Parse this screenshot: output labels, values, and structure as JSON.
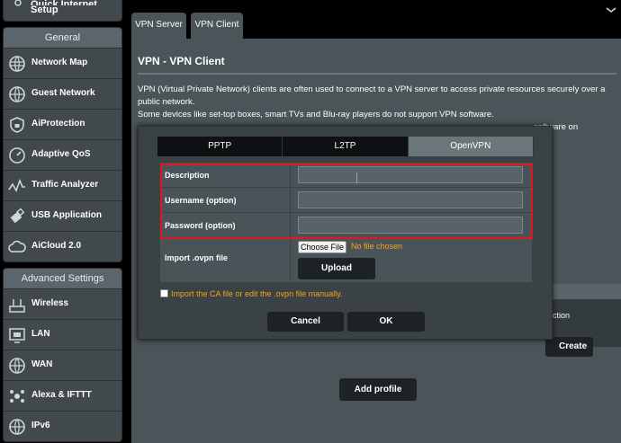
{
  "sidebar": {
    "top_item": {
      "label_top": "Quick Internet",
      "label": "Setup"
    },
    "general": {
      "header": "General",
      "items": [
        {
          "label": "Network Map",
          "icon": "network-map-icon"
        },
        {
          "label": "Guest Network",
          "icon": "globe-icon"
        },
        {
          "label": "AiProtection",
          "icon": "shield-lock-icon"
        },
        {
          "label": "Adaptive QoS",
          "icon": "qos-gauge-icon"
        },
        {
          "label": "Traffic Analyzer",
          "icon": "traffic-chart-icon"
        },
        {
          "label": "USB Application",
          "icon": "usb-icon"
        },
        {
          "label": "AiCloud 2.0",
          "icon": "cloud-icon"
        }
      ]
    },
    "advanced": {
      "header": "Advanced Settings",
      "items": [
        {
          "label": "Wireless",
          "icon": "wireless-icon"
        },
        {
          "label": "LAN",
          "icon": "lan-icon"
        },
        {
          "label": "WAN",
          "icon": "wan-globe-icon"
        },
        {
          "label": "Alexa & IFTTT",
          "icon": "alexa-ifttt-icon"
        },
        {
          "label": "IPv6",
          "icon": "ipv6-globe-icon"
        }
      ]
    }
  },
  "tabs": {
    "server": "VPN Server",
    "client": "VPN Client"
  },
  "panel": {
    "title": "VPN - VPN Client",
    "desc_line1": "VPN (Virtual Private Network) clients are often used to connect to a VPN server to access private resources securely over a",
    "desc_line2": "public network.",
    "desc_line3": "Some devices like set-top boxes, smart TVs and Blu-ray players do not support VPN software.",
    "desc_line4_tail": "software on"
  },
  "background": {
    "card_text": "ction",
    "create_label": "Create",
    "add_profile": "Add profile"
  },
  "modal": {
    "protocol_tabs": [
      "PPTP",
      "L2TP",
      "OpenVPN"
    ],
    "active_tab": "OpenVPN",
    "fields": {
      "description": {
        "label": "Description",
        "value": ""
      },
      "username": {
        "label": "Username (option)",
        "value": ""
      },
      "password": {
        "label": "Password (option)",
        "value": ""
      }
    },
    "import": {
      "label": "Import .ovpn file",
      "choose_file": "Choose File",
      "no_file": "No file chosen",
      "upload": "Upload"
    },
    "ca_checkbox": {
      "label": "Import the CA file or edit the .ovpn file manually.",
      "checked": false
    },
    "cancel": "Cancel",
    "ok": "OK"
  },
  "colors": {
    "highlight_border": "#e3161c",
    "warning_text": "#f2a51a",
    "panel_bg": "#4b5458",
    "button_bg": "#1d2224"
  }
}
